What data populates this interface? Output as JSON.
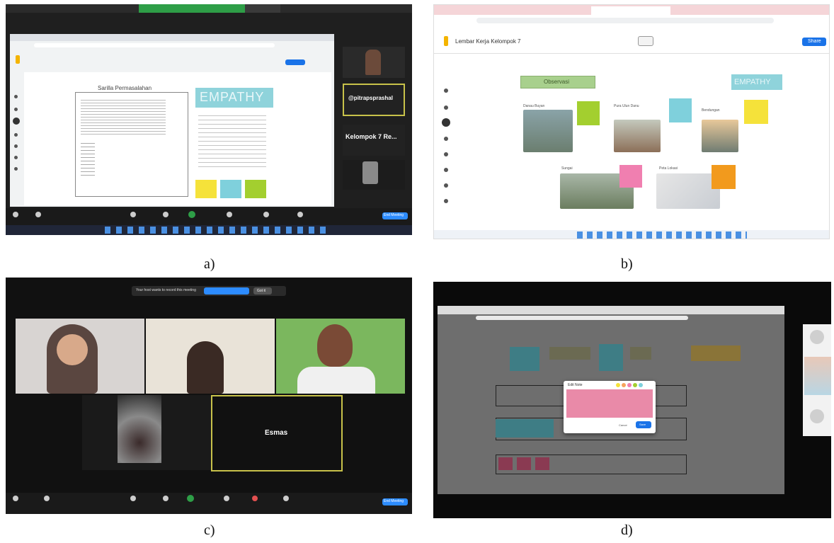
{
  "captions": {
    "a": "a)",
    "b": "b)",
    "c": "c)",
    "d": "d)"
  },
  "panel_a": {
    "doc_title": "Sarilla Permasalahan",
    "card_title": "EMPATHY",
    "tile_right_1": "@pitrapsprashal",
    "tile_right_2": "Kelompok 7 Re...",
    "end_button": "End Meeting",
    "colors": {
      "meeting_bg": "#1f1f1f",
      "accent": "#2d8cff",
      "empathy": "#8fd3db",
      "highlight": "#c8c24a"
    }
  },
  "panel_b": {
    "board_title": "Lembar Kerja Kelompok 7",
    "share_button": "Share",
    "label_green": "Observasi",
    "label_blue": "EMPATHY",
    "photo_captions": [
      "Danau Buyan",
      "Pura Ulun Danu",
      "Bendungan",
      "Sungai",
      "Peta Lokasi"
    ],
    "sticky_colors": [
      "#a3cf2f",
      "#7fd0dc",
      "#f5e23a",
      "#f07fb0",
      "#f29a1d"
    ]
  },
  "panel_c": {
    "banner_text": "Your host wants to record this meeting",
    "banner_button": "Got it",
    "tile_name": "Esmas",
    "end_button": "End Meeting"
  },
  "panel_d": {
    "dialog_title": "Edit Note",
    "dialog_cancel": "Cancel",
    "dialog_ok": "Save",
    "dialog_colors": [
      "#f5e23a",
      "#f7a35c",
      "#f07fb0",
      "#a3cf2f",
      "#7fd0dc"
    ]
  }
}
